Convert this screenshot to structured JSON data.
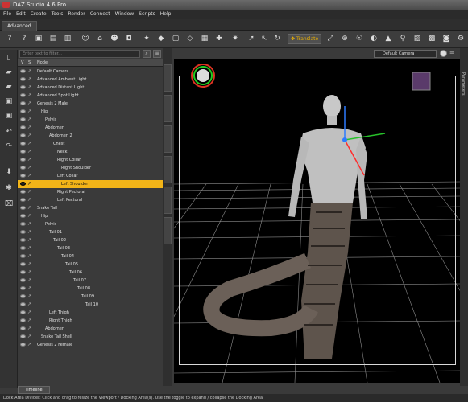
{
  "window": {
    "title": "DAZ Studio 4.6 Pro"
  },
  "menu": [
    "File",
    "Edit",
    "Create",
    "Tools",
    "Render",
    "Connect",
    "Window",
    "Scripts",
    "Help"
  ],
  "tab": {
    "label": "Advanced"
  },
  "toolbar": {
    "translate_label": "Translate"
  },
  "scene": {
    "filter_placeholder": "Enter text to filter...",
    "columns": [
      "V",
      "S",
      "Node"
    ],
    "nodes": [
      {
        "label": "Default Camera",
        "depth": 0,
        "selected": false
      },
      {
        "label": "Advanced Ambient Light",
        "depth": 0,
        "selected": false
      },
      {
        "label": "Advanced Distant Light",
        "depth": 0,
        "selected": false
      },
      {
        "label": "Advanced Spot Light",
        "depth": 0,
        "selected": false
      },
      {
        "label": "Genesis 2 Male",
        "depth": 0,
        "selected": false
      },
      {
        "label": "Hip",
        "depth": 1,
        "selected": false
      },
      {
        "label": "Pelvis",
        "depth": 2,
        "selected": false
      },
      {
        "label": "Abdomen",
        "depth": 2,
        "selected": false
      },
      {
        "label": "Abdomen 2",
        "depth": 3,
        "selected": false
      },
      {
        "label": "Chest",
        "depth": 4,
        "selected": false
      },
      {
        "label": "Neck",
        "depth": 5,
        "selected": false
      },
      {
        "label": "Right Collar",
        "depth": 5,
        "selected": false
      },
      {
        "label": "Right Shoulder",
        "depth": 6,
        "selected": false
      },
      {
        "label": "Left Collar",
        "depth": 5,
        "selected": false
      },
      {
        "label": "Left Shoulder",
        "depth": 6,
        "selected": true
      },
      {
        "label": "Right Pectoral",
        "depth": 5,
        "selected": false
      },
      {
        "label": "Left Pectoral",
        "depth": 5,
        "selected": false
      },
      {
        "label": "Snake Tail",
        "depth": 0,
        "selected": false
      },
      {
        "label": "Hip",
        "depth": 1,
        "selected": false
      },
      {
        "label": "Pelvis",
        "depth": 2,
        "selected": false
      },
      {
        "label": "Tail 01",
        "depth": 3,
        "selected": false
      },
      {
        "label": "Tail 02",
        "depth": 4,
        "selected": false
      },
      {
        "label": "Tail 03",
        "depth": 5,
        "selected": false
      },
      {
        "label": "Tail 04",
        "depth": 6,
        "selected": false
      },
      {
        "label": "Tail 05",
        "depth": 7,
        "selected": false
      },
      {
        "label": "Tail 06",
        "depth": 8,
        "selected": false
      },
      {
        "label": "Tail 07",
        "depth": 9,
        "selected": false
      },
      {
        "label": "Tail 08",
        "depth": 10,
        "selected": false
      },
      {
        "label": "Tail 09",
        "depth": 11,
        "selected": false
      },
      {
        "label": "Tail 10",
        "depth": 12,
        "selected": false
      },
      {
        "label": "Left Thigh",
        "depth": 3,
        "selected": false
      },
      {
        "label": "Right Thigh",
        "depth": 3,
        "selected": false
      },
      {
        "label": "Abdomen",
        "depth": 2,
        "selected": false
      },
      {
        "label": "Snake Tail Shell",
        "depth": 1,
        "selected": false
      },
      {
        "label": "Genesis 2 Female",
        "depth": 0,
        "selected": false
      }
    ]
  },
  "viewport": {
    "camera": "Default Camera"
  },
  "side_tabs": [
    "Parameters"
  ],
  "timeline": {
    "label": "Timeline"
  },
  "status": {
    "text": "Dock Area Divider: Click and drag to resize the Viewport / Docking Area(s). Use the toggle to expand / collapse the Docking Area"
  }
}
